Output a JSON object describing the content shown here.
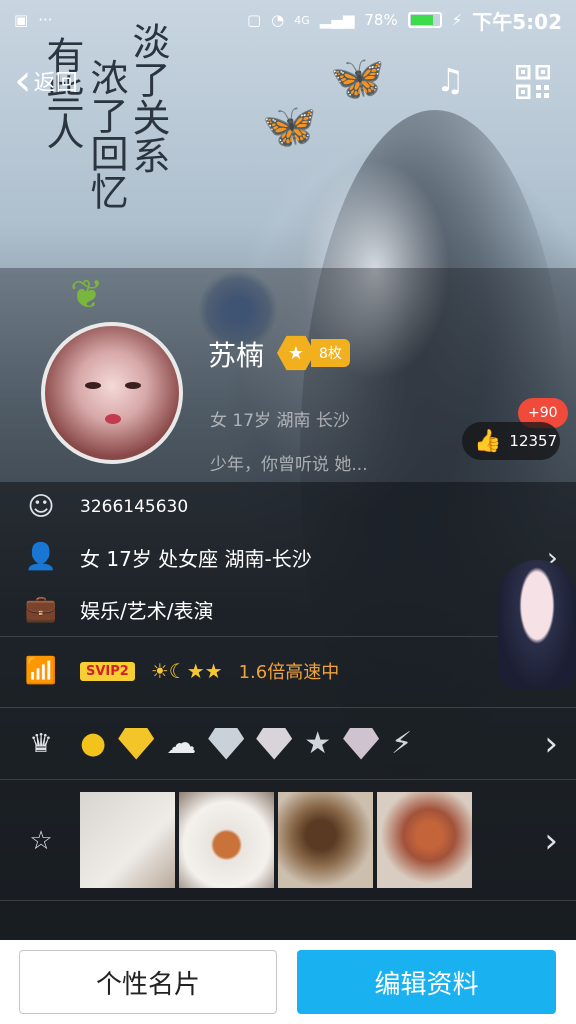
{
  "status_bar": {
    "battery_percent": "78%",
    "network": "4G",
    "time": "下午5:02",
    "battery_color": "#3ddc4a"
  },
  "nav": {
    "back_label": "返回"
  },
  "cover_art": {
    "lines": [
      "有些人",
      "浓了回忆",
      "淡了关系"
    ]
  },
  "profile": {
    "nickname": "苏楠",
    "medal_count": "8枚",
    "basic_info": "女  17岁  湖南  长沙",
    "signature": "少年，你曾听说  她...",
    "likes": "12357",
    "likes_delta": "+90"
  },
  "info": {
    "qq_number": "3266145630",
    "personal": "女    17岁    处女座    湖南-长沙",
    "occupation": "娱乐/艺术/表演",
    "vip_badge": "SVIP2",
    "vip_speed": "1.6倍高速中"
  },
  "buttons": {
    "card": "个性名片",
    "edit": "编辑资料"
  },
  "colors": {
    "accent": "#19b1f0",
    "vip_text": "#f2a33a",
    "likes_delta_bg": "#f04a3a"
  }
}
